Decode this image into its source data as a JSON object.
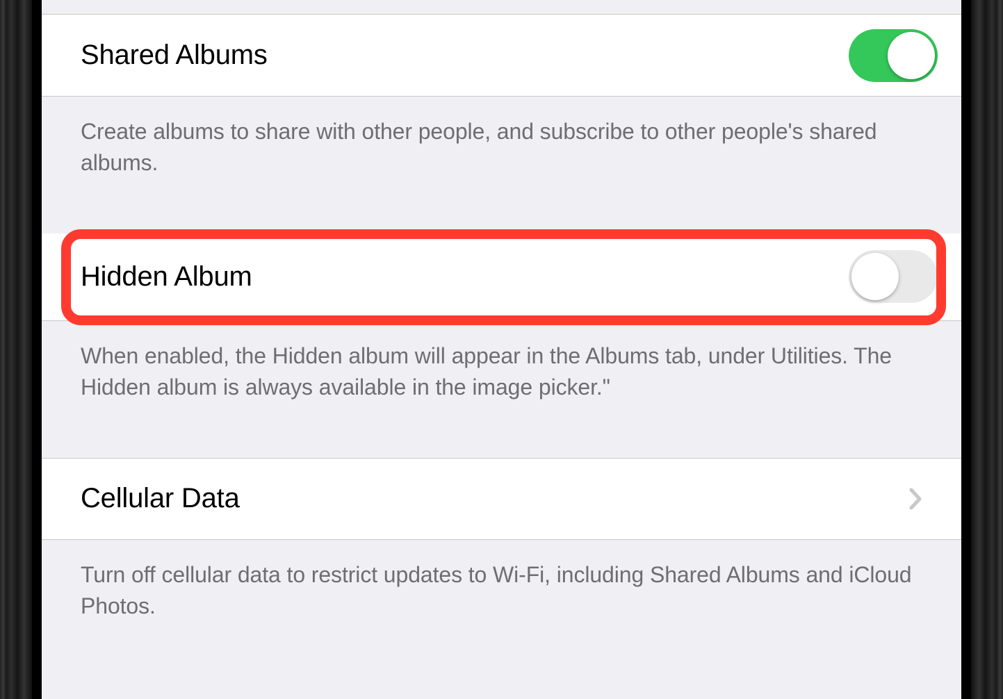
{
  "settings": {
    "sharedAlbums": {
      "label": "Shared Albums",
      "footer": "Create albums to share with other people, and subscribe to other people's shared albums.",
      "enabled": true
    },
    "hiddenAlbum": {
      "label": "Hidden Album",
      "footer": "When enabled, the Hidden album will appear in the Albums tab, under Utilities. The Hidden album is always available in the image picker.\"",
      "enabled": false
    },
    "cellularData": {
      "label": "Cellular Data",
      "footer": "Turn off cellular data to restrict updates to Wi-Fi, including Shared Albums and iCloud Photos."
    }
  }
}
